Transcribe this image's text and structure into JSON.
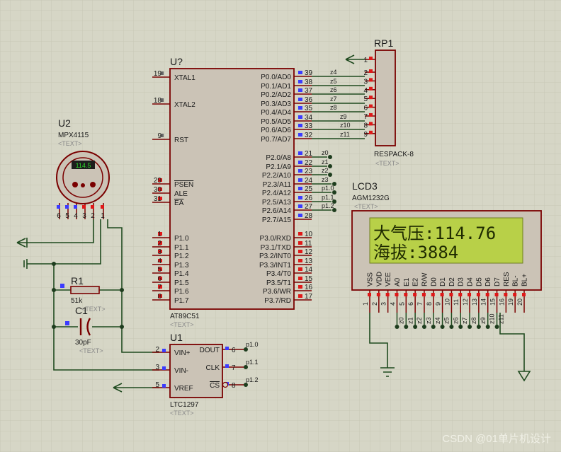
{
  "mcu": {
    "ref": "U?",
    "part": "AT89C51",
    "text": "<TEXT>",
    "left_pins": [
      {
        "num": "19",
        "name": "XTAL1"
      },
      {
        "num": "18",
        "name": "XTAL2"
      },
      {
        "num": "9",
        "name": "RST"
      },
      {
        "num": "29",
        "name": "PSEN"
      },
      {
        "num": "30",
        "name": "ALE"
      },
      {
        "num": "31",
        "name": "EA"
      },
      {
        "num": "1",
        "name": "P1.0"
      },
      {
        "num": "2",
        "name": "P1.1"
      },
      {
        "num": "3",
        "name": "P1.2"
      },
      {
        "num": "4",
        "name": "P1.3"
      },
      {
        "num": "5",
        "name": "P1.4"
      },
      {
        "num": "6",
        "name": "P1.5"
      },
      {
        "num": "7",
        "name": "P1.6"
      },
      {
        "num": "8",
        "name": "P1.7"
      }
    ],
    "right_pins": [
      {
        "num": "39",
        "name": "P0.0/AD0",
        "net": "z4"
      },
      {
        "num": "38",
        "name": "P0.1/AD1",
        "net": "z5"
      },
      {
        "num": "37",
        "name": "P0.2/AD2",
        "net": "z6"
      },
      {
        "num": "36",
        "name": "P0.3/AD3",
        "net": "z7"
      },
      {
        "num": "35",
        "name": "P0.4/AD4",
        "net": "z8"
      },
      {
        "num": "34",
        "name": "P0.5/AD5",
        "net": "z9"
      },
      {
        "num": "33",
        "name": "P0.6/AD6",
        "net": "z10"
      },
      {
        "num": "32",
        "name": "P0.7/AD7",
        "net": "z11"
      },
      {
        "num": "21",
        "name": "P2.0/A8",
        "net": "z0"
      },
      {
        "num": "22",
        "name": "P2.1/A9",
        "net": "z1"
      },
      {
        "num": "23",
        "name": "P2.2/A10",
        "net": "z2"
      },
      {
        "num": "24",
        "name": "P2.3/A11",
        "net": "z3"
      },
      {
        "num": "25",
        "name": "P2.4/A12",
        "net": "p1.0"
      },
      {
        "num": "26",
        "name": "P2.5/A13",
        "net": "p1.1"
      },
      {
        "num": "27",
        "name": "P2.6/A14",
        "net": "p1.2"
      },
      {
        "num": "28",
        "name": "P2.7/A15",
        "net": ""
      },
      {
        "num": "10",
        "name": "P3.0/RXD"
      },
      {
        "num": "11",
        "name": "P3.1/TXD"
      },
      {
        "num": "12",
        "name": "P3.2/INT0"
      },
      {
        "num": "13",
        "name": "P3.3/INT1"
      },
      {
        "num": "14",
        "name": "P3.4/T0"
      },
      {
        "num": "15",
        "name": "P3.5/T1"
      },
      {
        "num": "16",
        "name": "P3.6/WR"
      },
      {
        "num": "17",
        "name": "P3.7/RD"
      }
    ]
  },
  "rp1": {
    "ref": "RP1",
    "part": "RESPACK-8",
    "text": "<TEXT>",
    "pins": [
      "1",
      "2",
      "3",
      "4",
      "5",
      "6",
      "7",
      "8",
      "9"
    ]
  },
  "lcd": {
    "ref": "LCD3",
    "part": "AGM1232G",
    "text": "<TEXT>",
    "line1": "大气压:114.76",
    "line2": "海拔:3884",
    "pin_labels": [
      "VSS",
      "VDD",
      "VEE",
      "A0",
      "E1",
      "E2",
      "R/W",
      "D0",
      "D1",
      "D2",
      "D3",
      "D4",
      "D5",
      "D6",
      "D7",
      "RES",
      "BL-",
      "BL+"
    ],
    "pin_numbers": [
      "1",
      "2",
      "3",
      "4",
      "5",
      "6",
      "7",
      "8",
      "9",
      "10",
      "11",
      "12",
      "13",
      "14",
      "15",
      "16",
      "19",
      "20"
    ],
    "nets": [
      "",
      "",
      "",
      "z0",
      "z1",
      "z2",
      "z3",
      "z4",
      "z5",
      "z6",
      "z7",
      "z8",
      "z9",
      "z10",
      "z11",
      "",
      "",
      ""
    ]
  },
  "sensor": {
    "ref": "U2",
    "part": "MPX4115",
    "text": "<TEXT>",
    "display_value": "114.5",
    "pins": [
      "6",
      "5",
      "4",
      "3",
      "2",
      "1"
    ]
  },
  "r1": {
    "ref": "R1",
    "value": "51k",
    "text": "<TEXT>"
  },
  "c1": {
    "ref": "C1",
    "value": "30pF",
    "text": "<TEXT>"
  },
  "adc": {
    "ref": "U1",
    "part": "LTC1297",
    "text": "<TEXT>",
    "left_pins": [
      {
        "num": "2",
        "name": "VIN+"
      },
      {
        "num": "3",
        "name": "VIN-"
      },
      {
        "num": "5",
        "name": "VREF"
      }
    ],
    "right_pins": [
      {
        "num": "6",
        "name": "DOUT",
        "net": "p1.0"
      },
      {
        "num": "7",
        "name": "CLK",
        "net": "p1.1"
      },
      {
        "num": "8",
        "name": "CS",
        "net": "p1.2"
      }
    ]
  },
  "watermark": "CSDN @01单片机设计",
  "colors": {
    "background": "#d6d6c6",
    "grid": "#c4c4b2",
    "body_fill": "#cbc3b6",
    "body_stroke": "#7a0000",
    "pin_line": "#7a0000",
    "wire": "#1f4a1f",
    "junction": "#1e3d1e",
    "pin_marker_blue": "#3b3bff",
    "pin_marker_red": "#e01818",
    "lcd_screen": "#b8d048",
    "lcd_text": "#1e2a00",
    "label_gray": "#8a8a8a"
  }
}
